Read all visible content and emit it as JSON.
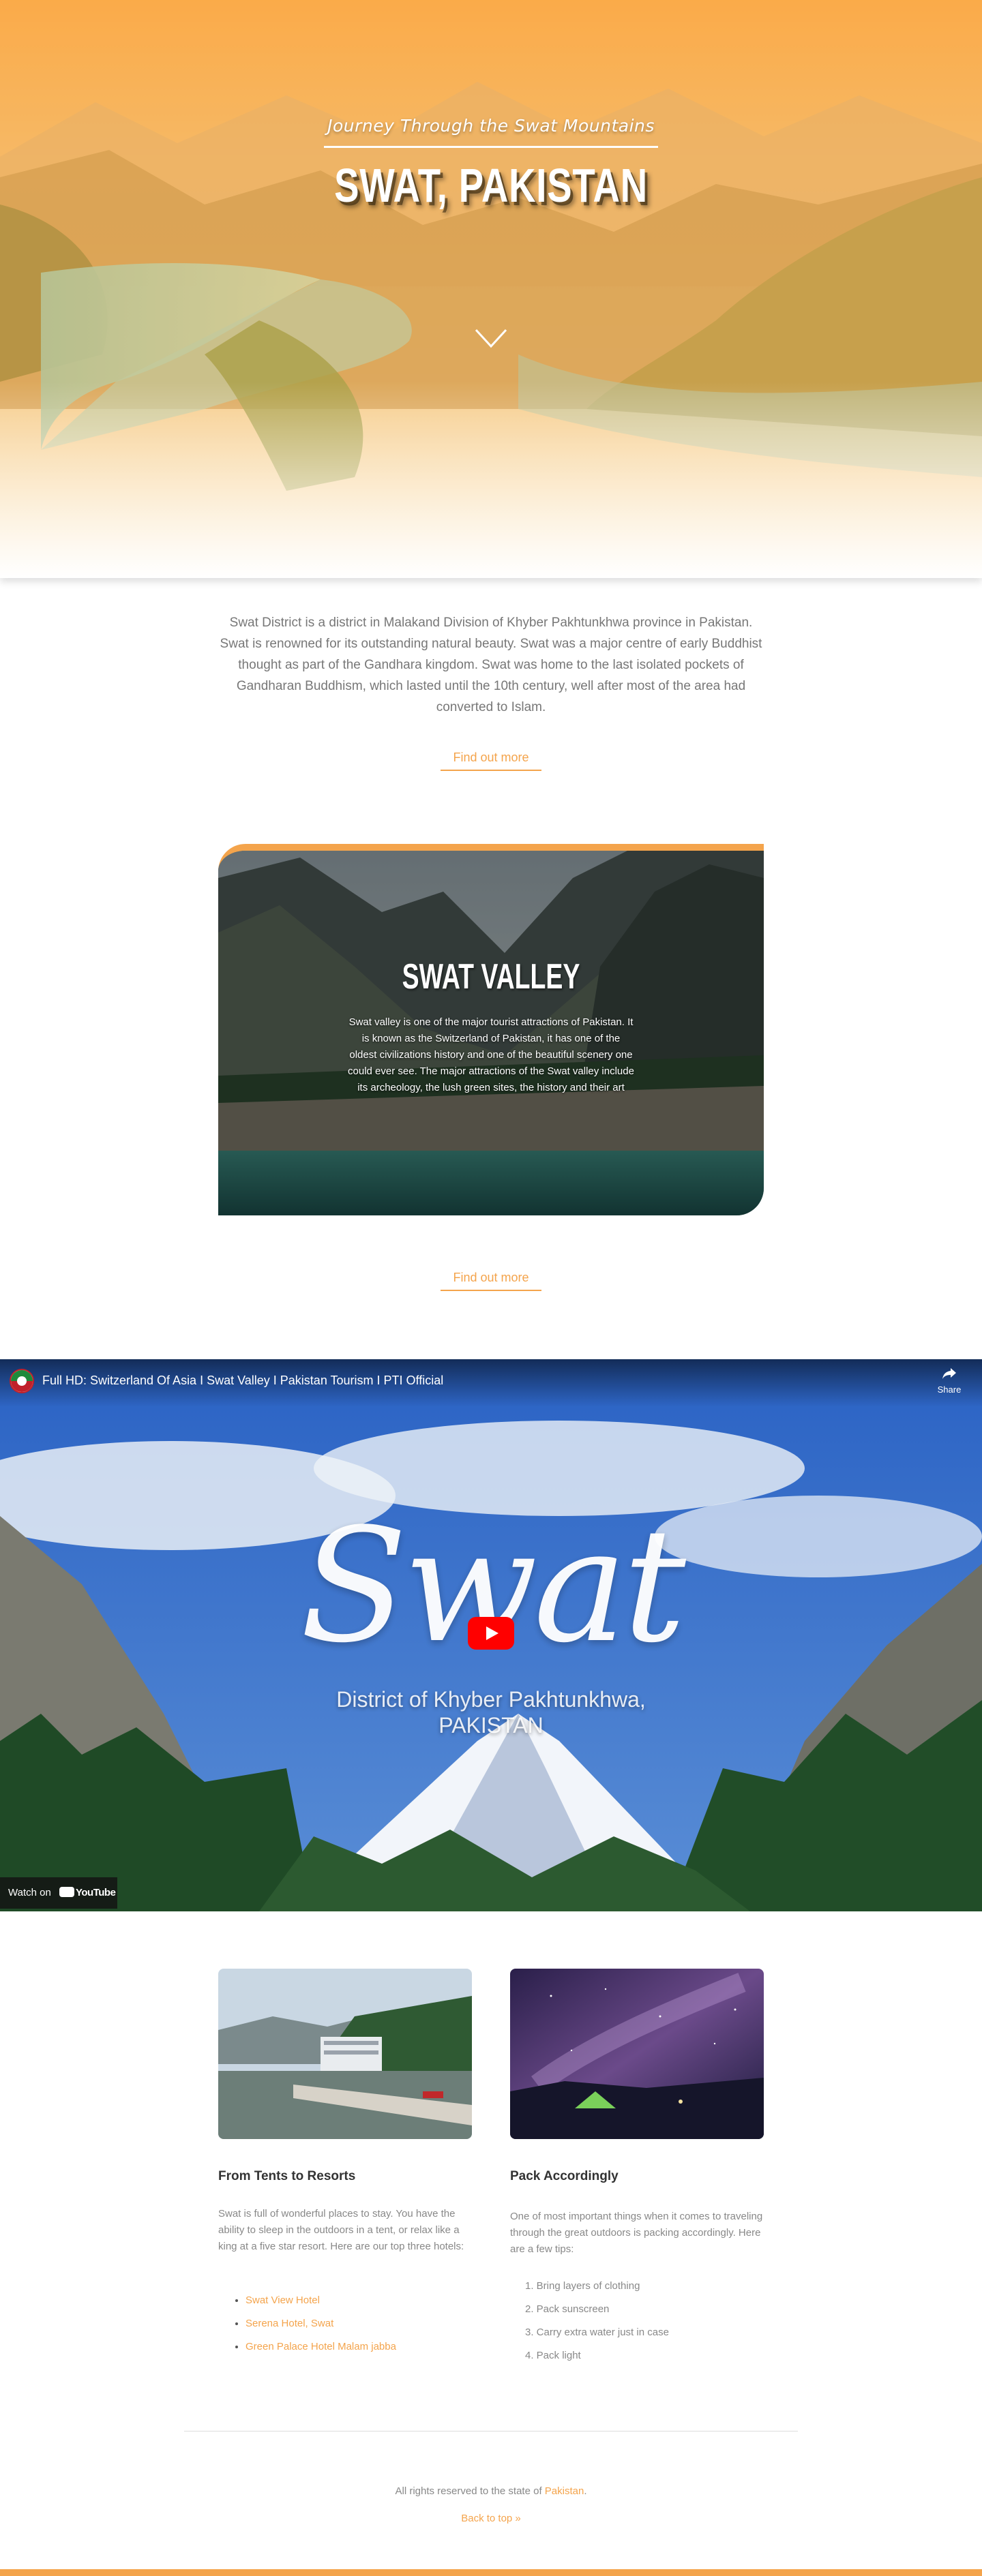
{
  "hero": {
    "subtitle": "Journey Through the Swat Mountains",
    "title": "SWAT, PAKISTAN",
    "scroll_icon": "chevron-down-icon"
  },
  "intro": {
    "text": "Swat District is a district in Malakand Division of Khyber Pakhtunkhwa province in Pakistan. Swat is renowned for its outstanding natural beauty. Swat was a major centre of early Buddhist thought as part of the Gandhara kingdom. Swat was home to the last isolated pockets of Gandharan Buddhism, which lasted until the 10th century, well after most of the area had converted to Islam.",
    "button": "Find out more"
  },
  "card": {
    "title": "SWAT VALLEY",
    "text": "Swat valley is one of the major tourist attractions of Pakistan. It is known as the Switzerland of Pakistan, it has one of the oldest civilizations history and one of the beautiful scenery one could ever see. The major attractions of the Swat valley include its archeology, the lush green sites, the history and their art",
    "button": "Find out more"
  },
  "video": {
    "title": "Full HD: Switzerland Of Asia I Swat Valley I Pakistan Tourism I PTI Official",
    "share": "Share",
    "overlay_word": "Swat",
    "overlay_line1": "District of Khyber Pakhtunkhwa,",
    "overlay_line2": "PAKISTAN",
    "watch_on": "Watch on",
    "youtube": "YouTube"
  },
  "resorts": {
    "title": "From Tents to Resorts",
    "text": "Swat is full of wonderful places to stay. You have the ability to sleep in the outdoors in a tent, or relax like a king at a five star resort. Here are our top three hotels:",
    "hotels": [
      "Swat View Hotel",
      "Serena Hotel, Swat",
      "Green Palace Hotel Malam jabba"
    ]
  },
  "pack": {
    "title": "Pack Accordingly",
    "text": "One of most important things when it comes to traveling through the great outdoors is packing accordingly. Here are a few tips:",
    "tips": [
      "1. Bring layers of clothing",
      "2. Pack sunscreen",
      "3. Carry extra water just in case",
      "4. Pack light"
    ]
  },
  "footer": {
    "text": "All rights reserved to the state of",
    "link": "Pakistan",
    "period": ".",
    "back_to_top": "Back to top »"
  },
  "colors": {
    "accent": "#f4a44c",
    "text": "#777777"
  }
}
